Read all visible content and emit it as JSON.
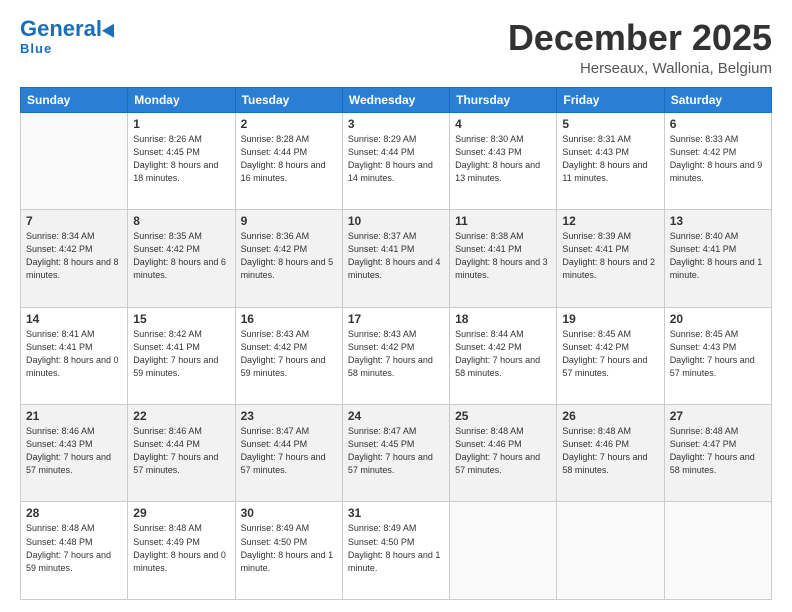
{
  "header": {
    "logo_general": "General",
    "logo_blue": "Blue",
    "month_title": "December 2025",
    "location": "Herseaux, Wallonia, Belgium"
  },
  "days_of_week": [
    "Sunday",
    "Monday",
    "Tuesday",
    "Wednesday",
    "Thursday",
    "Friday",
    "Saturday"
  ],
  "weeks": [
    [
      {
        "day": "",
        "detail": ""
      },
      {
        "day": "1",
        "detail": "Sunrise: 8:26 AM\nSunset: 4:45 PM\nDaylight: 8 hours\nand 18 minutes."
      },
      {
        "day": "2",
        "detail": "Sunrise: 8:28 AM\nSunset: 4:44 PM\nDaylight: 8 hours\nand 16 minutes."
      },
      {
        "day": "3",
        "detail": "Sunrise: 8:29 AM\nSunset: 4:44 PM\nDaylight: 8 hours\nand 14 minutes."
      },
      {
        "day": "4",
        "detail": "Sunrise: 8:30 AM\nSunset: 4:43 PM\nDaylight: 8 hours\nand 13 minutes."
      },
      {
        "day": "5",
        "detail": "Sunrise: 8:31 AM\nSunset: 4:43 PM\nDaylight: 8 hours\nand 11 minutes."
      },
      {
        "day": "6",
        "detail": "Sunrise: 8:33 AM\nSunset: 4:42 PM\nDaylight: 8 hours\nand 9 minutes."
      }
    ],
    [
      {
        "day": "7",
        "detail": "Sunrise: 8:34 AM\nSunset: 4:42 PM\nDaylight: 8 hours\nand 8 minutes."
      },
      {
        "day": "8",
        "detail": "Sunrise: 8:35 AM\nSunset: 4:42 PM\nDaylight: 8 hours\nand 6 minutes."
      },
      {
        "day": "9",
        "detail": "Sunrise: 8:36 AM\nSunset: 4:42 PM\nDaylight: 8 hours\nand 5 minutes."
      },
      {
        "day": "10",
        "detail": "Sunrise: 8:37 AM\nSunset: 4:41 PM\nDaylight: 8 hours\nand 4 minutes."
      },
      {
        "day": "11",
        "detail": "Sunrise: 8:38 AM\nSunset: 4:41 PM\nDaylight: 8 hours\nand 3 minutes."
      },
      {
        "day": "12",
        "detail": "Sunrise: 8:39 AM\nSunset: 4:41 PM\nDaylight: 8 hours\nand 2 minutes."
      },
      {
        "day": "13",
        "detail": "Sunrise: 8:40 AM\nSunset: 4:41 PM\nDaylight: 8 hours\nand 1 minute."
      }
    ],
    [
      {
        "day": "14",
        "detail": "Sunrise: 8:41 AM\nSunset: 4:41 PM\nDaylight: 8 hours\nand 0 minutes."
      },
      {
        "day": "15",
        "detail": "Sunrise: 8:42 AM\nSunset: 4:41 PM\nDaylight: 7 hours\nand 59 minutes."
      },
      {
        "day": "16",
        "detail": "Sunrise: 8:43 AM\nSunset: 4:42 PM\nDaylight: 7 hours\nand 59 minutes."
      },
      {
        "day": "17",
        "detail": "Sunrise: 8:43 AM\nSunset: 4:42 PM\nDaylight: 7 hours\nand 58 minutes."
      },
      {
        "day": "18",
        "detail": "Sunrise: 8:44 AM\nSunset: 4:42 PM\nDaylight: 7 hours\nand 58 minutes."
      },
      {
        "day": "19",
        "detail": "Sunrise: 8:45 AM\nSunset: 4:42 PM\nDaylight: 7 hours\nand 57 minutes."
      },
      {
        "day": "20",
        "detail": "Sunrise: 8:45 AM\nSunset: 4:43 PM\nDaylight: 7 hours\nand 57 minutes."
      }
    ],
    [
      {
        "day": "21",
        "detail": "Sunrise: 8:46 AM\nSunset: 4:43 PM\nDaylight: 7 hours\nand 57 minutes."
      },
      {
        "day": "22",
        "detail": "Sunrise: 8:46 AM\nSunset: 4:44 PM\nDaylight: 7 hours\nand 57 minutes."
      },
      {
        "day": "23",
        "detail": "Sunrise: 8:47 AM\nSunset: 4:44 PM\nDaylight: 7 hours\nand 57 minutes."
      },
      {
        "day": "24",
        "detail": "Sunrise: 8:47 AM\nSunset: 4:45 PM\nDaylight: 7 hours\nand 57 minutes."
      },
      {
        "day": "25",
        "detail": "Sunrise: 8:48 AM\nSunset: 4:46 PM\nDaylight: 7 hours\nand 57 minutes."
      },
      {
        "day": "26",
        "detail": "Sunrise: 8:48 AM\nSunset: 4:46 PM\nDaylight: 7 hours\nand 58 minutes."
      },
      {
        "day": "27",
        "detail": "Sunrise: 8:48 AM\nSunset: 4:47 PM\nDaylight: 7 hours\nand 58 minutes."
      }
    ],
    [
      {
        "day": "28",
        "detail": "Sunrise: 8:48 AM\nSunset: 4:48 PM\nDaylight: 7 hours\nand 59 minutes."
      },
      {
        "day": "29",
        "detail": "Sunrise: 8:48 AM\nSunset: 4:49 PM\nDaylight: 8 hours\nand 0 minutes."
      },
      {
        "day": "30",
        "detail": "Sunrise: 8:49 AM\nSunset: 4:50 PM\nDaylight: 8 hours\nand 1 minute."
      },
      {
        "day": "31",
        "detail": "Sunrise: 8:49 AM\nSunset: 4:50 PM\nDaylight: 8 hours\nand 1 minute."
      },
      {
        "day": "",
        "detail": ""
      },
      {
        "day": "",
        "detail": ""
      },
      {
        "day": "",
        "detail": ""
      }
    ]
  ]
}
